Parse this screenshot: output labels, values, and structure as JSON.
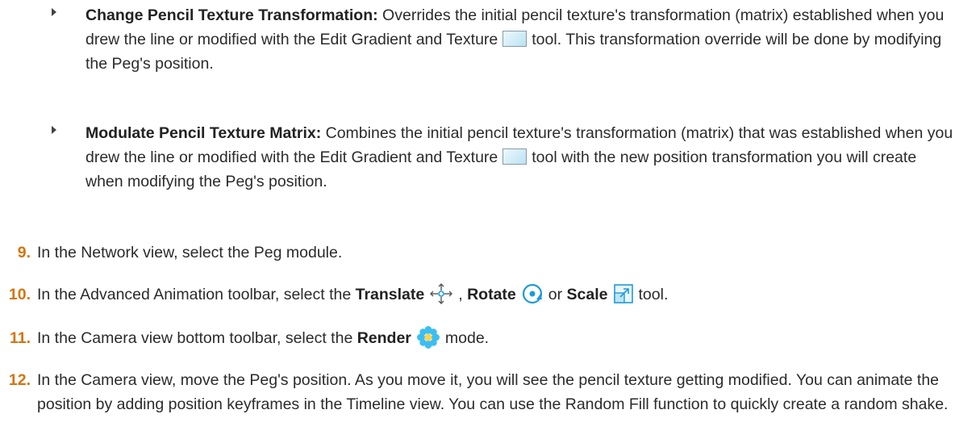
{
  "bullets": [
    {
      "title": "Change Pencil Texture Transformation:",
      "text_before_icon": " Overrides the initial pencil texture's transformation (matrix) established when you drew the line or modified with the Edit Gradient and Texture",
      "text_after_icon": "tool. This transformation override will be done by modifying the Peg's position.",
      "icon": "edit-gradient-texture-icon"
    },
    {
      "title": "Modulate Pencil Texture Matrix:",
      "text_before_icon": " Combines the initial pencil texture's transformation (matrix) that was established when you drew the line or modified with the Edit Gradient and Texture",
      "text_after_icon": "tool with the new position transformation you will create when modifying the Peg's position.",
      "icon": "edit-gradient-texture-icon"
    }
  ],
  "steps": [
    {
      "number": "9.",
      "text": "In the Network view, select the Peg module."
    },
    {
      "number": "10.",
      "text_1": "In the Advanced Animation toolbar, select the ",
      "bold_1": "Translate",
      "text_2": ", ",
      "bold_2": "Rotate",
      "text_3": "or ",
      "bold_3": "Scale",
      "text_4": "tool."
    },
    {
      "number": "11.",
      "text_1": "In the Camera view bottom toolbar, select the ",
      "bold_1": "Render",
      "text_2": "mode."
    },
    {
      "number": "12.",
      "text": "In the Camera view, move the Peg's position. As you move it, you will see the pencil texture getting modified. You can animate the position by adding position keyframes in the Timeline view. You can use the Random Fill function to quickly create a random shake."
    }
  ],
  "colors": {
    "step_number": "#d4740d",
    "text": "#2b2b2b",
    "render_icon": "#3cbef0",
    "rotate_icon": "#1e9bd8"
  },
  "icons": [
    "edit-gradient-texture-icon",
    "translate-icon",
    "rotate-icon",
    "scale-icon",
    "render-mode-icon"
  ]
}
